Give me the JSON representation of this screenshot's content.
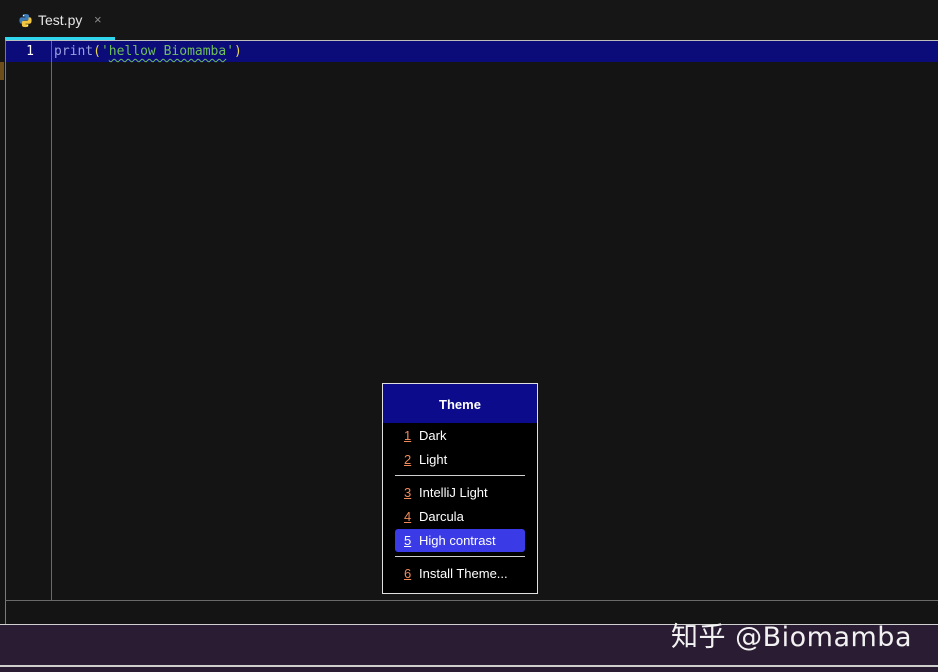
{
  "tab": {
    "filename": "Test.py",
    "close_glyph": "×",
    "icon": "python-icon"
  },
  "editor": {
    "line_number": "1",
    "code": {
      "fn": "print",
      "open": "(",
      "str_open_quote": "'",
      "str_text": "hellow Biomamba",
      "str_close_quote": "'",
      "close": ")"
    }
  },
  "popup": {
    "title": "Theme",
    "items": [
      {
        "num": "1",
        "label": "Dark"
      },
      {
        "num": "2",
        "label": "Light"
      },
      {
        "num": "3",
        "label": "IntelliJ Light"
      },
      {
        "num": "4",
        "label": "Darcula"
      },
      {
        "num": "5",
        "label": "High contrast",
        "selected": true
      },
      {
        "num": "6",
        "label": "Install Theme..."
      }
    ]
  },
  "watermark": "知乎 @Biomamba",
  "colors": {
    "accent": "#2fd6ee",
    "selection": "#3a3ae6",
    "header": "#0b0b8c",
    "mnemonic": "#f08a5b"
  }
}
